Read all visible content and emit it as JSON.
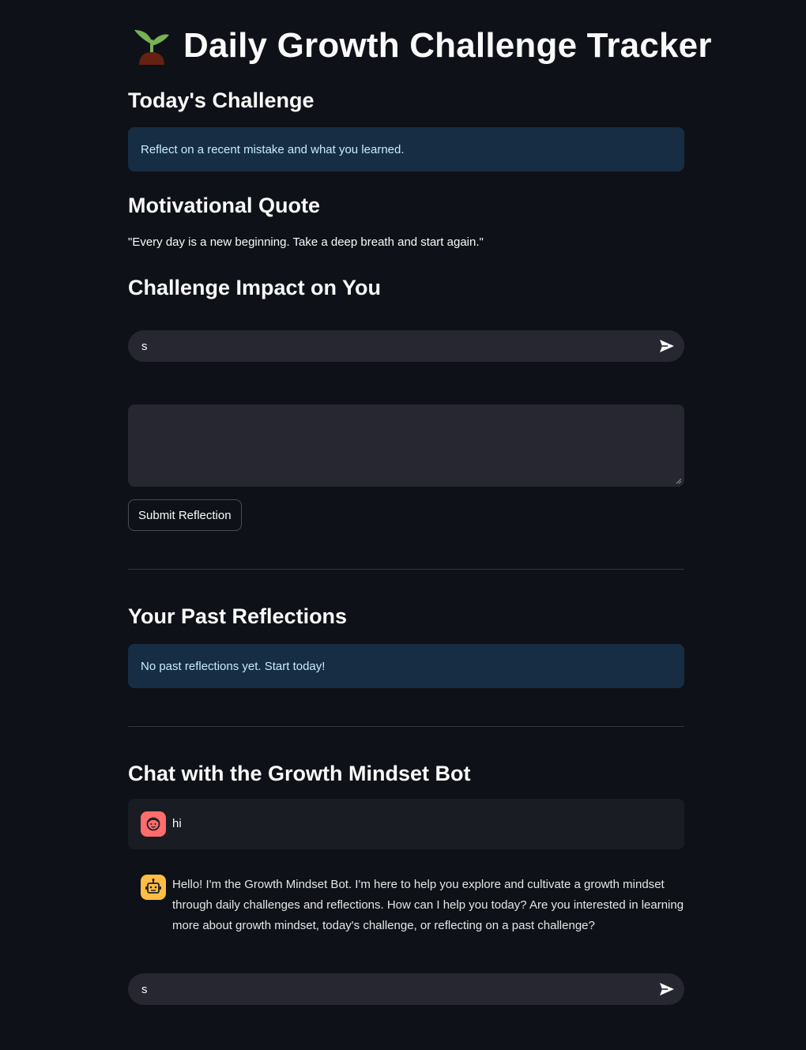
{
  "app": {
    "title_icon": "seedling-icon",
    "title": "Daily Growth Challenge Tracker"
  },
  "challenge": {
    "heading": "Today's Challenge",
    "text": "Reflect on a recent mistake and what you learned."
  },
  "quote": {
    "heading": "Motivational Quote",
    "text": "\"Every day is a new beginning. Take a deep breath and start again.\""
  },
  "impact": {
    "heading": "Challenge Impact on You",
    "input_value": "s",
    "send_icon": "send-icon",
    "reflection_value": "",
    "submit_label": "Submit Reflection"
  },
  "past": {
    "heading": "Your Past Reflections",
    "empty_text": "No past reflections yet. Start today!"
  },
  "chat": {
    "heading": "Chat with the Growth Mindset Bot",
    "messages": [
      {
        "role": "user",
        "avatar_icon": "user-face-icon",
        "text": "hi"
      },
      {
        "role": "assistant",
        "avatar_icon": "robot-icon",
        "text": "Hello! I'm the Growth Mindset Bot. I'm here to help you explore and cultivate a growth mindset through daily challenges and reflections. How can I help you today? Are you interested in learning more about growth mindset, today's challenge, or reflecting on a past challenge?"
      }
    ],
    "input_value": "s",
    "send_icon": "send-icon"
  },
  "colors": {
    "background": "#0e1117",
    "info_background": "#172d43",
    "info_text": "#c7ebff",
    "input_background": "#262730",
    "user_avatar": "#ff6c6c",
    "bot_avatar": "#ffbd45"
  }
}
